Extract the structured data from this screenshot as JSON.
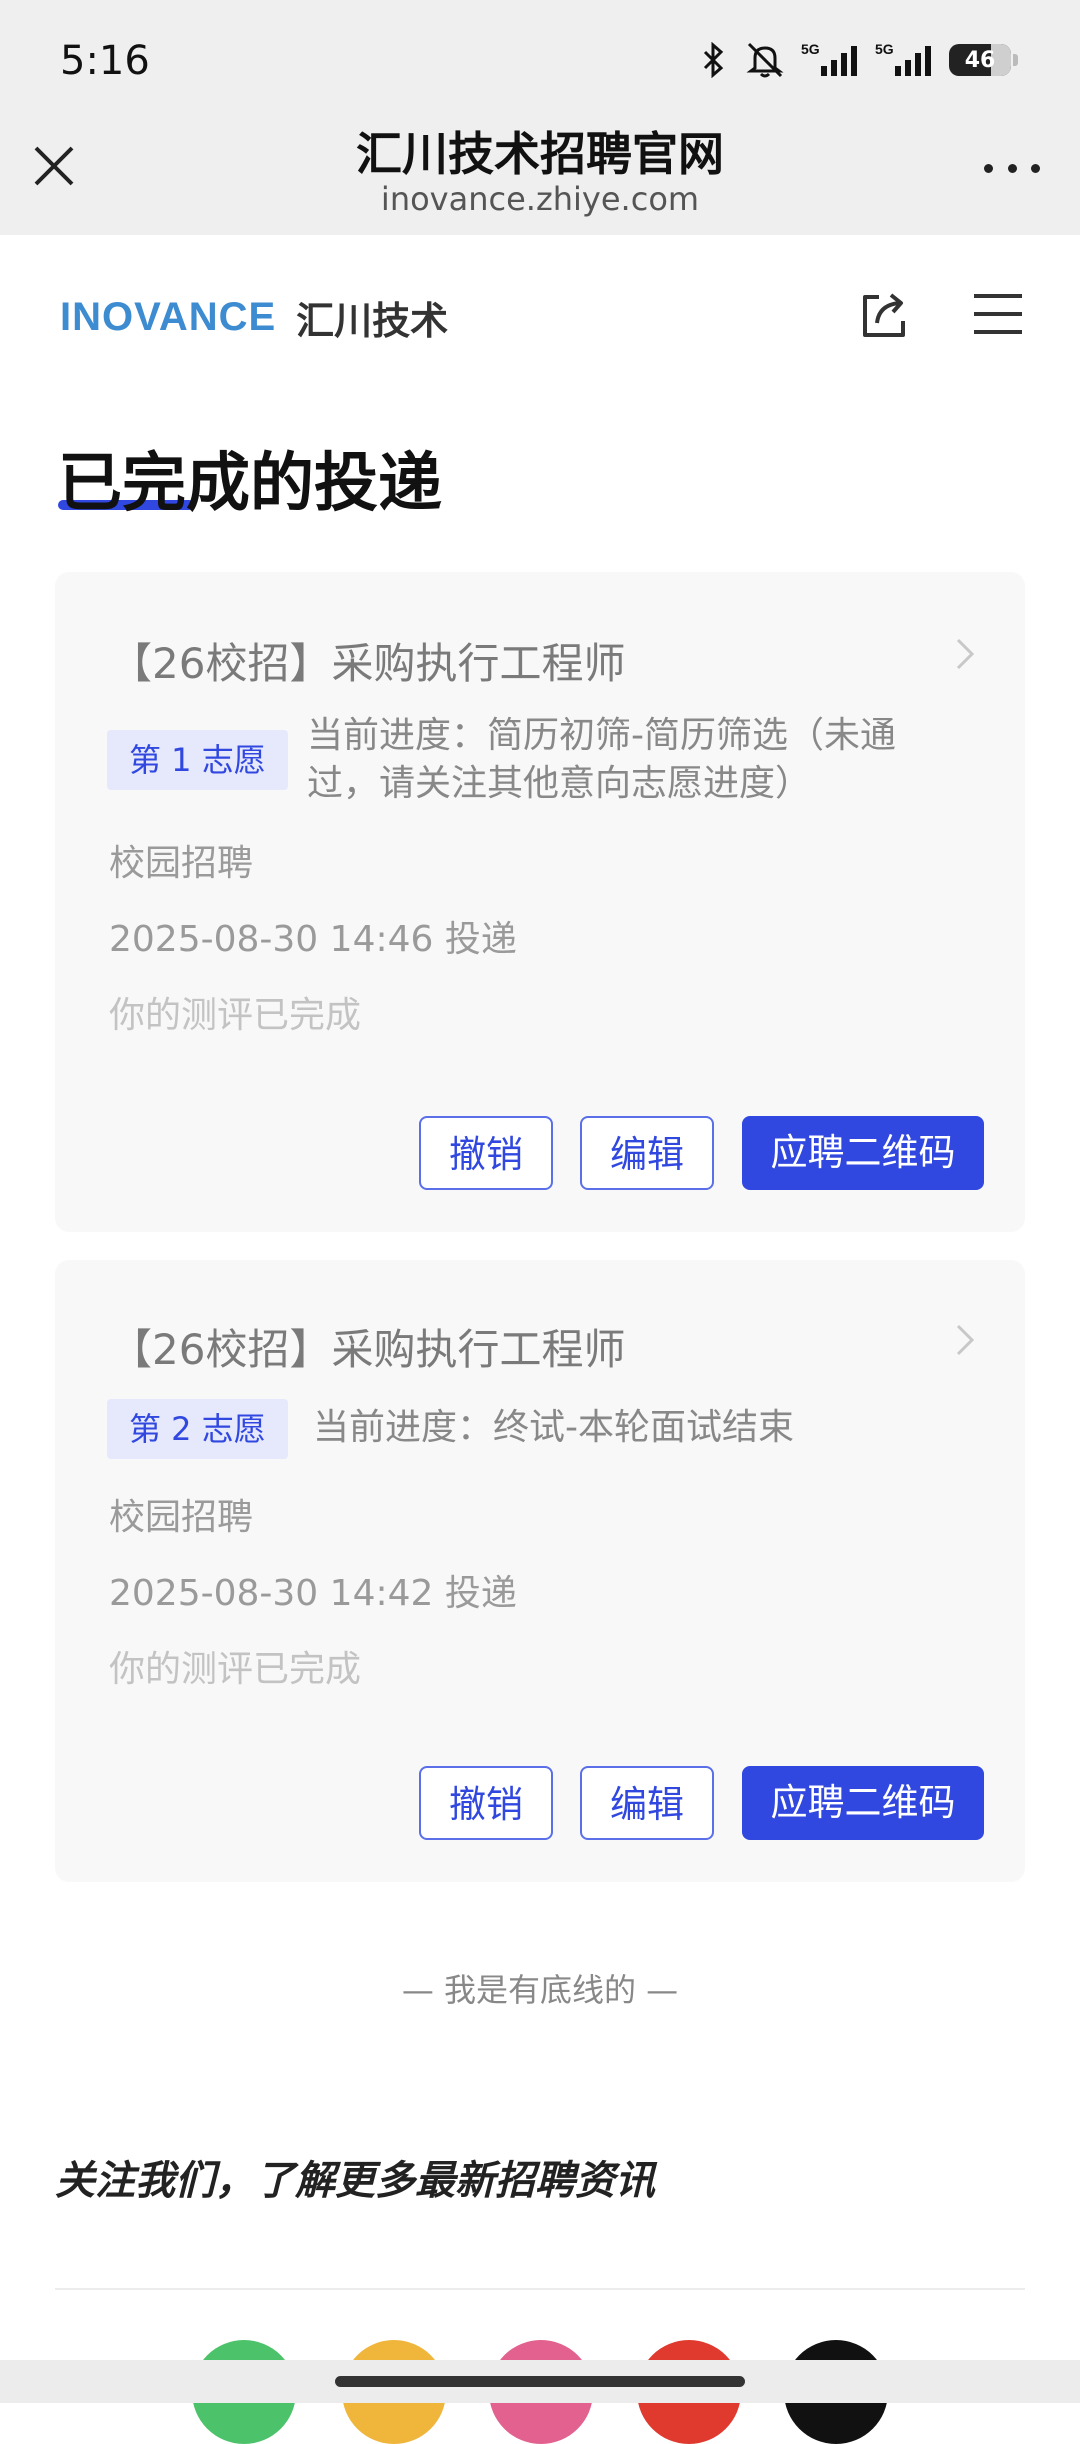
{
  "status_bar": {
    "time": "5:16",
    "battery": "46",
    "network_1": "5G",
    "network_2": "5G"
  },
  "browser": {
    "title": "汇川技术招聘官网",
    "url": "inovance.zhiye.com"
  },
  "site_header": {
    "brand_en": "INOVANCE",
    "brand_cn": "汇川技术"
  },
  "page": {
    "title": "已完成的投递"
  },
  "applications": [
    {
      "title": "【26校招】采购执行工程师",
      "tag": "第 1 志愿",
      "progress": "当前进度：简历初筛-简历筛选（未通过，请关注其他意向志愿进度）",
      "type": "校园招聘",
      "submitted": "2025-08-30 14:46 投递",
      "assessment": "你的测评已完成",
      "buttons": {
        "cancel": "撤销",
        "edit": "编辑",
        "qrcode": "应聘二维码"
      }
    },
    {
      "title": "【26校招】采购执行工程师",
      "tag": "第 2 志愿",
      "progress": "当前进度：终试-本轮面试结束",
      "type": "校园招聘",
      "submitted": "2025-08-30 14:42 投递",
      "assessment": "你的测评已完成",
      "buttons": {
        "cancel": "撤销",
        "edit": "编辑",
        "qrcode": "应聘二维码"
      }
    }
  ],
  "footer": {
    "end_text": "— 我是有底线的 —",
    "follow_text": "关注我们，了解更多最新招聘资讯"
  },
  "colors": {
    "accent": "#3148e0",
    "brand_blue": "#3d8bd0",
    "social": [
      "#4cc36a",
      "#f0b63c",
      "#e2618f",
      "#e03a2f",
      "#111111"
    ]
  }
}
